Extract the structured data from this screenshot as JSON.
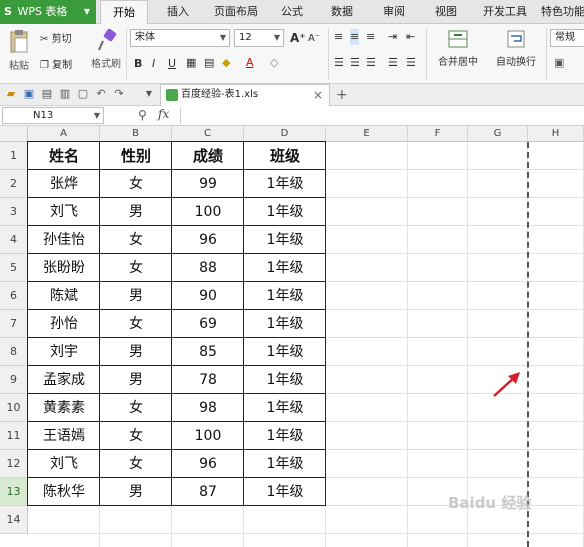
{
  "app": {
    "brand": "WPS 表格",
    "tabs": [
      "开始",
      "插入",
      "页面布局",
      "公式",
      "数据",
      "审阅",
      "视图",
      "开发工具",
      "特色功能"
    ]
  },
  "ribbon": {
    "paste_label": "粘贴",
    "cut_label": "剪切",
    "copy_label": "复制",
    "format_painter_label": "格式刷",
    "font_name": "宋体",
    "font_size": "12",
    "merge_center_label": "合并居中",
    "auto_wrap_label": "自动换行",
    "number_format": "常规"
  },
  "document": {
    "tab_title": "百度经验-表1.xls"
  },
  "formula_bar": {
    "name_box": "N13",
    "fx_label": "fx",
    "formula": ""
  },
  "sheet": {
    "columns": [
      "A",
      "B",
      "C",
      "D",
      "E",
      "F",
      "G",
      "H"
    ],
    "row_numbers": [
      "1",
      "2",
      "3",
      "4",
      "5",
      "6",
      "7",
      "8",
      "9",
      "10",
      "11",
      "12",
      "13",
      "14"
    ],
    "selected_row": "13",
    "headers": [
      "姓名",
      "性别",
      "成绩",
      "班级"
    ],
    "rows": [
      [
        "张烨",
        "女",
        "99",
        "1年级"
      ],
      [
        "刘飞",
        "男",
        "100",
        "1年级"
      ],
      [
        "孙佳怡",
        "女",
        "96",
        "1年级"
      ],
      [
        "张盼盼",
        "女",
        "88",
        "1年级"
      ],
      [
        "陈斌",
        "男",
        "90",
        "1年级"
      ],
      [
        "孙怡",
        "女",
        "69",
        "1年级"
      ],
      [
        "刘宇",
        "男",
        "85",
        "1年级"
      ],
      [
        "孟家成",
        "男",
        "78",
        "1年级"
      ],
      [
        "黄素素",
        "女",
        "98",
        "1年级"
      ],
      [
        "王语嫣",
        "女",
        "100",
        "1年级"
      ],
      [
        "刘飞",
        "女",
        "96",
        "1年级"
      ],
      [
        "陈秋华",
        "男",
        "87",
        "1年级"
      ]
    ]
  },
  "watermark": "Baidu 经验",
  "colors": {
    "brand_green": "#3a9b3a",
    "arrow_red": "#d0202a"
  }
}
